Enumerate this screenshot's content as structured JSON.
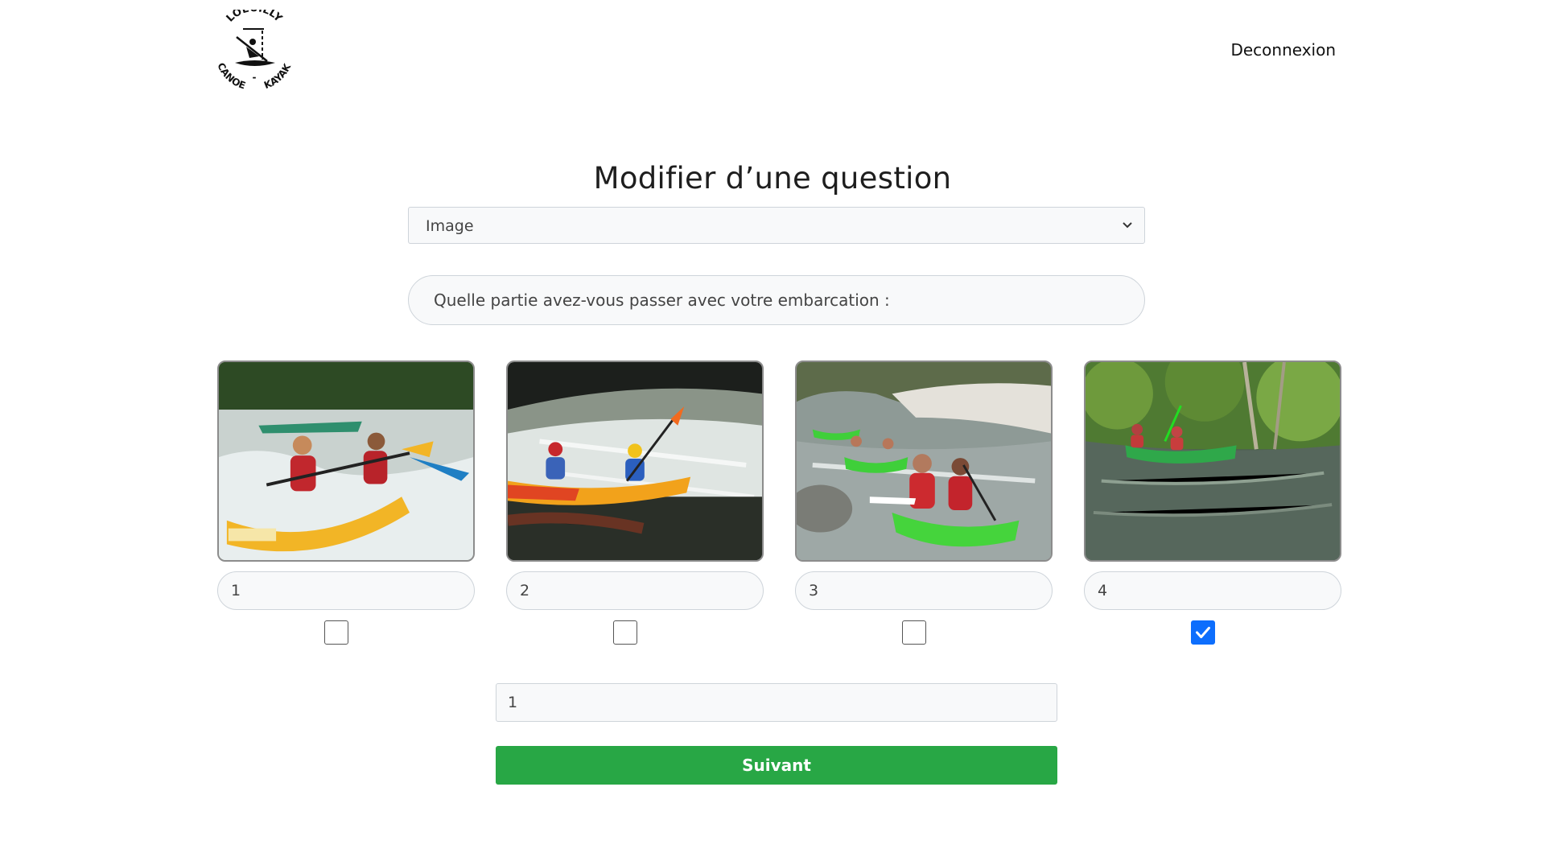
{
  "header": {
    "logo_text_top": "LOEUILLY",
    "logo_text_bottom_left": "CANOE",
    "logo_text_bottom_right": "KAYAK",
    "logout_label": "Deconnexion"
  },
  "main": {
    "title": "Modifier d’une question",
    "question_type": {
      "selected": "Image"
    },
    "question_text": "Quelle partie avez-vous passer avec votre embarcation :",
    "choices": [
      {
        "label": "1",
        "checked": false,
        "scene": "yellow-canoe-rapids"
      },
      {
        "label": "2",
        "checked": false,
        "scene": "orange-canoe-weir"
      },
      {
        "label": "3",
        "checked": false,
        "scene": "green-canoes-river"
      },
      {
        "label": "4",
        "checked": true,
        "scene": "green-canoe-forest"
      }
    ],
    "answer_value": "1",
    "next_label": "Suivant"
  },
  "colors": {
    "accent": "#28a745",
    "checkbox_checked": "#0d6efd"
  }
}
